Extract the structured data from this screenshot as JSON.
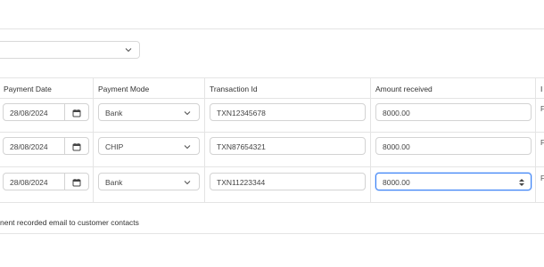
{
  "filter": {
    "value": ""
  },
  "table": {
    "columns": [
      "Payment Date",
      "Payment Mode",
      "Transaction Id",
      "Amount received",
      "I"
    ],
    "rows": [
      {
        "date": "28/08/2024",
        "mode": "Bank",
        "txn": "TXN12345678",
        "amount": "8000.00",
        "edge": "F"
      },
      {
        "date": "28/08/2024",
        "mode": "CHIP",
        "txn": "TXN87654321",
        "amount": "8000.00",
        "edge": "F"
      },
      {
        "date": "28/08/2024",
        "mode": "Bank",
        "txn": "TXN11223344",
        "amount": "8000.00",
        "edge": "F"
      }
    ]
  },
  "footer": {
    "text": "nent recorded email to customer contacts"
  },
  "icons": {
    "select": "chevron-down-icon",
    "date": "calendar-icon",
    "number": "spinner-icon"
  },
  "colors": {
    "focus": "#3b82f6",
    "border": "#d3d3d3"
  }
}
